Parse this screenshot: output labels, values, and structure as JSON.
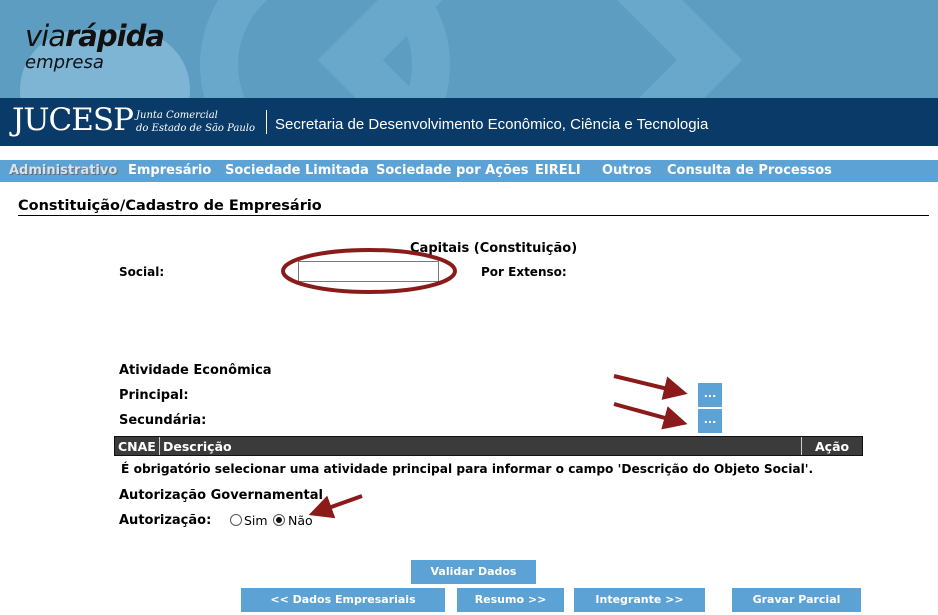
{
  "brand": {
    "logo_via": "via",
    "logo_rapida": "rápida",
    "logo_empresa": "empresa",
    "jucesp": "JUCESP",
    "jucesp_sub_line1": "Junta Comercial",
    "jucesp_sub_line2": "do Estado de São Paulo",
    "secretaria": "Secretaria de Desenvolvimento Econômico, Ciência e Tecnologia"
  },
  "nav": {
    "items": [
      "Administrativo",
      "Empresário",
      "Sociedade Limitada",
      "Sociedade por Ações",
      "EIRELI",
      "Outros",
      "Consulta de Processos"
    ],
    "active": "Administrativo"
  },
  "page": {
    "title": "Constituição/Cadastro de Empresário"
  },
  "capitais": {
    "heading": "Capitais (Constituição)",
    "social_label": "Social:",
    "social_value": "",
    "extenso_label": "Por Extenso:"
  },
  "atividade": {
    "heading": "Atividade Econômica",
    "principal_label": "Principal:",
    "secundaria_label": "Secundária:",
    "lookup_button": "...",
    "table_headers": [
      "CNAE",
      "Descrição",
      "Ação"
    ],
    "notice": "É obrigatório selecionar uma atividade principal para informar o campo 'Descrição do Objeto Social'."
  },
  "autorizacao": {
    "heading": "Autorização Governamental",
    "label": "Autorização:",
    "options": [
      "Sim",
      "Não"
    ],
    "selected": "Não"
  },
  "buttons": {
    "validar": "Validar Dados",
    "dados_empresariais": "<< Dados Empresariais",
    "resumo": "Resumo >>",
    "integrante": "Integrante >>",
    "gravar_parcial": "Gravar Parcial"
  },
  "colors": {
    "banner": "#5d9dc1",
    "jucesp_bar": "#0a3a67",
    "nav": "#5da2d4",
    "button": "#5da2d4",
    "annotation": "#8b1a1a"
  }
}
